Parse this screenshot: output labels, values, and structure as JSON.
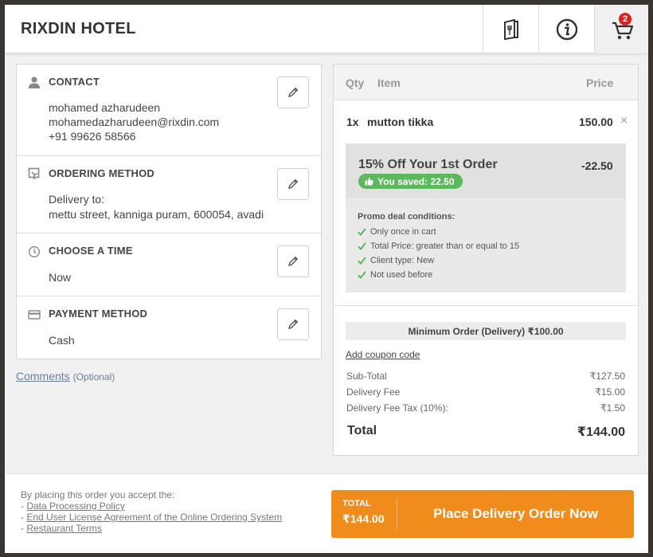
{
  "header": {
    "hotel_name": "RIXDIN HOTEL",
    "menu_icon": "menu-book-icon",
    "info_icon": "info-icon",
    "cart_icon": "cart-icon",
    "cart_count": "2"
  },
  "contact": {
    "title": "CONTACT",
    "name": "mohamed azharudeen",
    "email": "mohamedazharudeen@rixdin.com",
    "phone": "+91 99626 58566"
  },
  "ordering": {
    "title": "ORDERING METHOD",
    "label": "Delivery to:",
    "address": "mettu street, kanniga puram, 600054, avadi"
  },
  "time": {
    "title": "CHOOSE A TIME",
    "value": "Now"
  },
  "payment": {
    "title": "PAYMENT METHOD",
    "value": "Cash"
  },
  "comments": {
    "link": "Comments",
    "optional": "(Optional)"
  },
  "cart": {
    "headers": {
      "qty": "Qty",
      "item": "Item",
      "price": "Price"
    },
    "items": [
      {
        "qty": "1x",
        "name": "mutton tikka",
        "price": "150.00",
        "remove": "×"
      }
    ],
    "promo": {
      "title": "15% Off Your 1st Order",
      "amount": "-22.50",
      "saved": "You saved: 22.50",
      "conditions_title": "Promo deal conditions:",
      "conditions": [
        "Only once in cart",
        "Total Price: greater than or equal to 15",
        "Client type: New",
        "Not used before"
      ]
    },
    "min_order": "Minimum Order (Delivery) ₹100.00",
    "coupon_link": "Add coupon code",
    "subtotal_label": "Sub-Total",
    "subtotal": "₹127.50",
    "delivery_fee_label": "Delivery Fee",
    "delivery_fee": "₹15.00",
    "delivery_tax_label": "Delivery Fee Tax (10%):",
    "delivery_tax": "₹1.50",
    "total_label": "Total",
    "total": "₹144.00"
  },
  "footer": {
    "terms_intro": "By placing this order you accept the:",
    "terms": [
      "Data Processing Policy",
      "End User License Agreement of the Online Ordering System",
      "Restaurant Terms"
    ],
    "total_label": "TOTAL",
    "total_value": "₹144.00",
    "button_label": "Place Delivery Order Now"
  },
  "colors": {
    "accent": "#f08c1c",
    "success": "#5cb85c",
    "badge": "#e02020"
  }
}
